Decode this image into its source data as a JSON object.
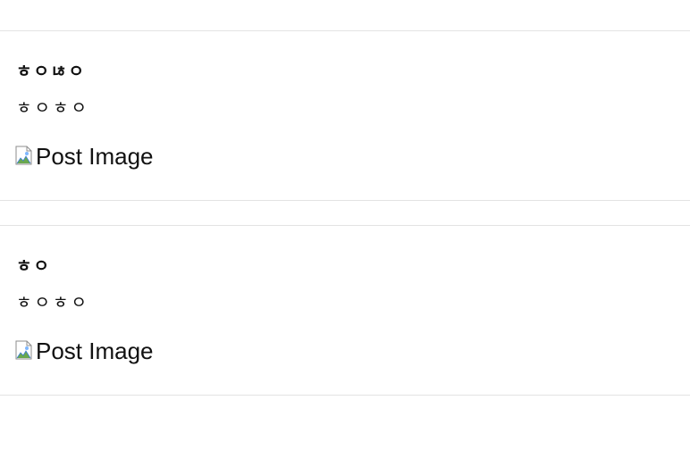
{
  "posts": [
    {
      "title": "ㅎㅇㄶㅇ",
      "body": "ㅎㅇㅎㅇ",
      "image_alt": "Post Image"
    },
    {
      "title": "ㅎㅇ",
      "body": "ㅎㅇㅎㅇ",
      "image_alt": "Post Image"
    }
  ],
  "icons": {
    "broken_image": "broken-image-icon"
  },
  "colors": {
    "background": "#ffffff",
    "text": "#111111",
    "divider": "#e3e3e3"
  }
}
